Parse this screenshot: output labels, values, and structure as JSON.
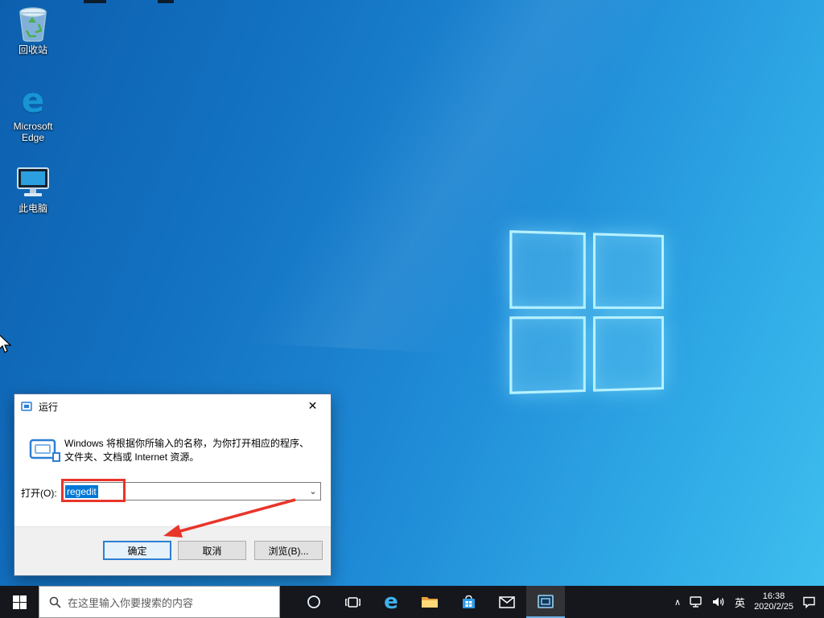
{
  "glyphs": {
    "close": "✕",
    "combo_chevron": "⌄",
    "tray_chevron": "∧",
    "edge_letter": "e"
  },
  "desktop": {
    "icons": [
      {
        "label": "回收站"
      },
      {
        "label": "Microsoft Edge"
      },
      {
        "label": "此电脑"
      }
    ]
  },
  "run_dialog": {
    "title": "运行",
    "description_line1": "Windows 将根据你所输入的名称，为你打开相应的程序、",
    "description_line2": "文件夹、文档或 Internet 资源。",
    "open_label": "打开(O):",
    "input_value": "regedit",
    "buttons": {
      "ok": "确定",
      "cancel": "取消",
      "browse": "浏览(B)..."
    }
  },
  "taskbar": {
    "search_placeholder": "在这里输入你要搜索的内容",
    "tray": {
      "language": "英",
      "time": "16:38",
      "date": "2020/2/25"
    }
  }
}
